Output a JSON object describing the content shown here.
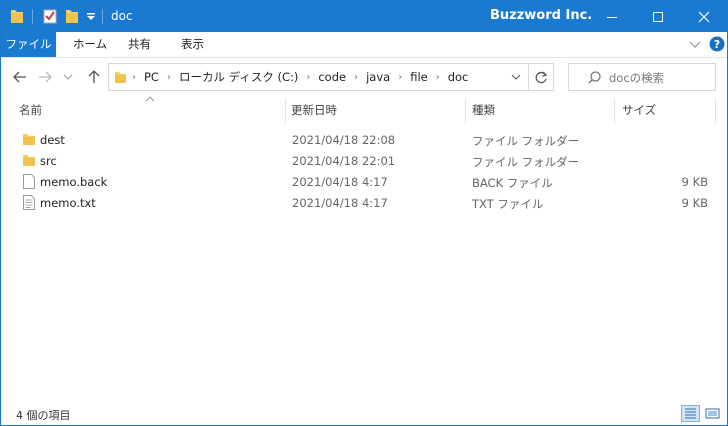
{
  "window": {
    "title": "doc",
    "brand": "Buzzword Inc.",
    "controls": {
      "minimize": "minimize-icon",
      "maximize": "maximize-icon",
      "close": "close-icon"
    }
  },
  "ribbon": {
    "tabs": [
      {
        "label": "ファイル",
        "active": true
      },
      {
        "label": "ホーム"
      },
      {
        "label": "共有"
      },
      {
        "label": "表示"
      }
    ]
  },
  "address": {
    "crumbs": [
      "PC",
      "ローカル ディスク (C:)",
      "code",
      "java",
      "file",
      "doc"
    ]
  },
  "search": {
    "placeholder": "docの検索"
  },
  "columns": {
    "name": "名前",
    "date": "更新日時",
    "type": "種類",
    "size": "サイズ"
  },
  "files": [
    {
      "name": "dest",
      "date": "2021/04/18 22:08",
      "type": "ファイル フォルダー",
      "size": "",
      "icon": "folder-icon"
    },
    {
      "name": "src",
      "date": "2021/04/18 22:01",
      "type": "ファイル フォルダー",
      "size": "",
      "icon": "folder-icon"
    },
    {
      "name": "memo.back",
      "date": "2021/04/18 4:17",
      "type": "BACK ファイル",
      "size": "9 KB",
      "icon": "file-icon"
    },
    {
      "name": "memo.txt",
      "date": "2021/04/18 4:17",
      "type": "TXT ファイル",
      "size": "9 KB",
      "icon": "text-file-icon"
    }
  ],
  "status": {
    "count": "4 個の項目"
  },
  "colors": {
    "accent": "#1a79d0",
    "folder": "#f2c14e"
  }
}
